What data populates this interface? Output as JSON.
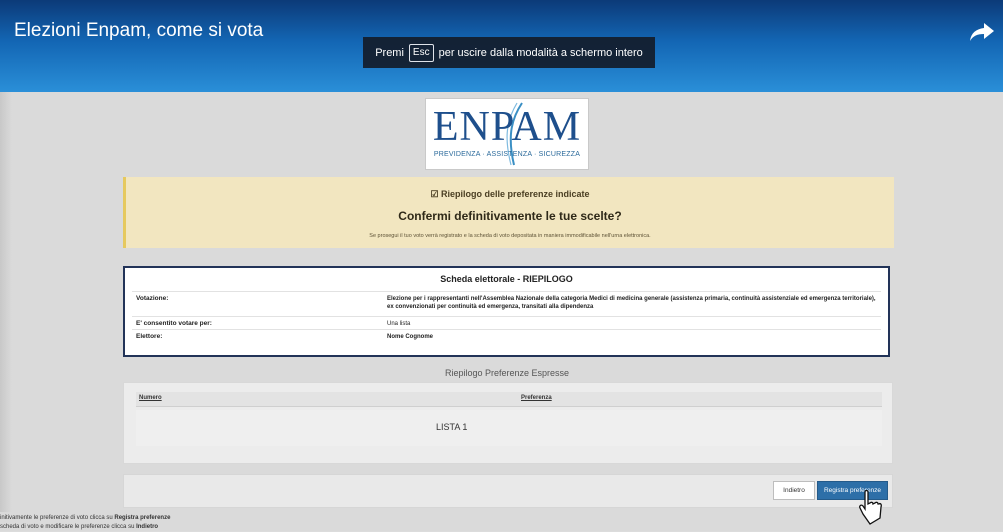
{
  "player": {
    "title": "Elezioni Enpam, come si vota",
    "fullscreen_hint": {
      "before": "Premi",
      "key": "Esc",
      "after": "per uscire dalla modalità a schermo intero"
    },
    "share_icon": "share-arrow-icon"
  },
  "logo": {
    "word": "ENPAM",
    "tagline": "PREVIDENZA · ASSISTENZA · SICUREZZA"
  },
  "notice": {
    "heading": "☑ Riepilogo delle preferenze indicate",
    "question": "Confermi definitivamente le tue scelte?",
    "note": "Se prosegui il tuo voto verrà registrato e la scheda di voto depositata in maniera immodificabile nell'urna elettronica.",
    "colors": {
      "background": "#f2e6c0",
      "accent": "#e6c95e"
    }
  },
  "summary": {
    "title": "Scheda elettorale - RIEPILOGO",
    "rows": [
      {
        "label": "Votazione:",
        "value": "Elezione per i rappresentanti nell'Assemblea Nazionale della categoria Medici di medicina generale (assistenza primaria, continuità assistenziale ed emergenza territoriale), ex convenzionati per continuità ed emergenza, transitati alla dipendenza"
      },
      {
        "label": "E' consentito votare per:",
        "value": "Una lista"
      },
      {
        "label": "Elettore:",
        "value": "Nome Cognome"
      }
    ]
  },
  "preferences": {
    "caption": "Riepilogo Preferenze Espresse",
    "columns": [
      "Numero",
      "Preferenza"
    ],
    "rows": [
      {
        "number": "",
        "preference": "LISTA 1"
      }
    ]
  },
  "actions": {
    "back": "Indietro",
    "save": "Registra preferenze",
    "save_color": "#2d6fa8"
  },
  "hint": {
    "line1_pre": "initivamente le preferenze di voto clicca su ",
    "line1_bold": "Registra preferenze",
    "line2_pre": "scheda di voto e modificare le preferenze clicca su ",
    "line2_bold": "Indietro"
  },
  "colors": {
    "topbar": "#1366b4",
    "summary_border": "#223358",
    "page_bg": "#dadada"
  }
}
